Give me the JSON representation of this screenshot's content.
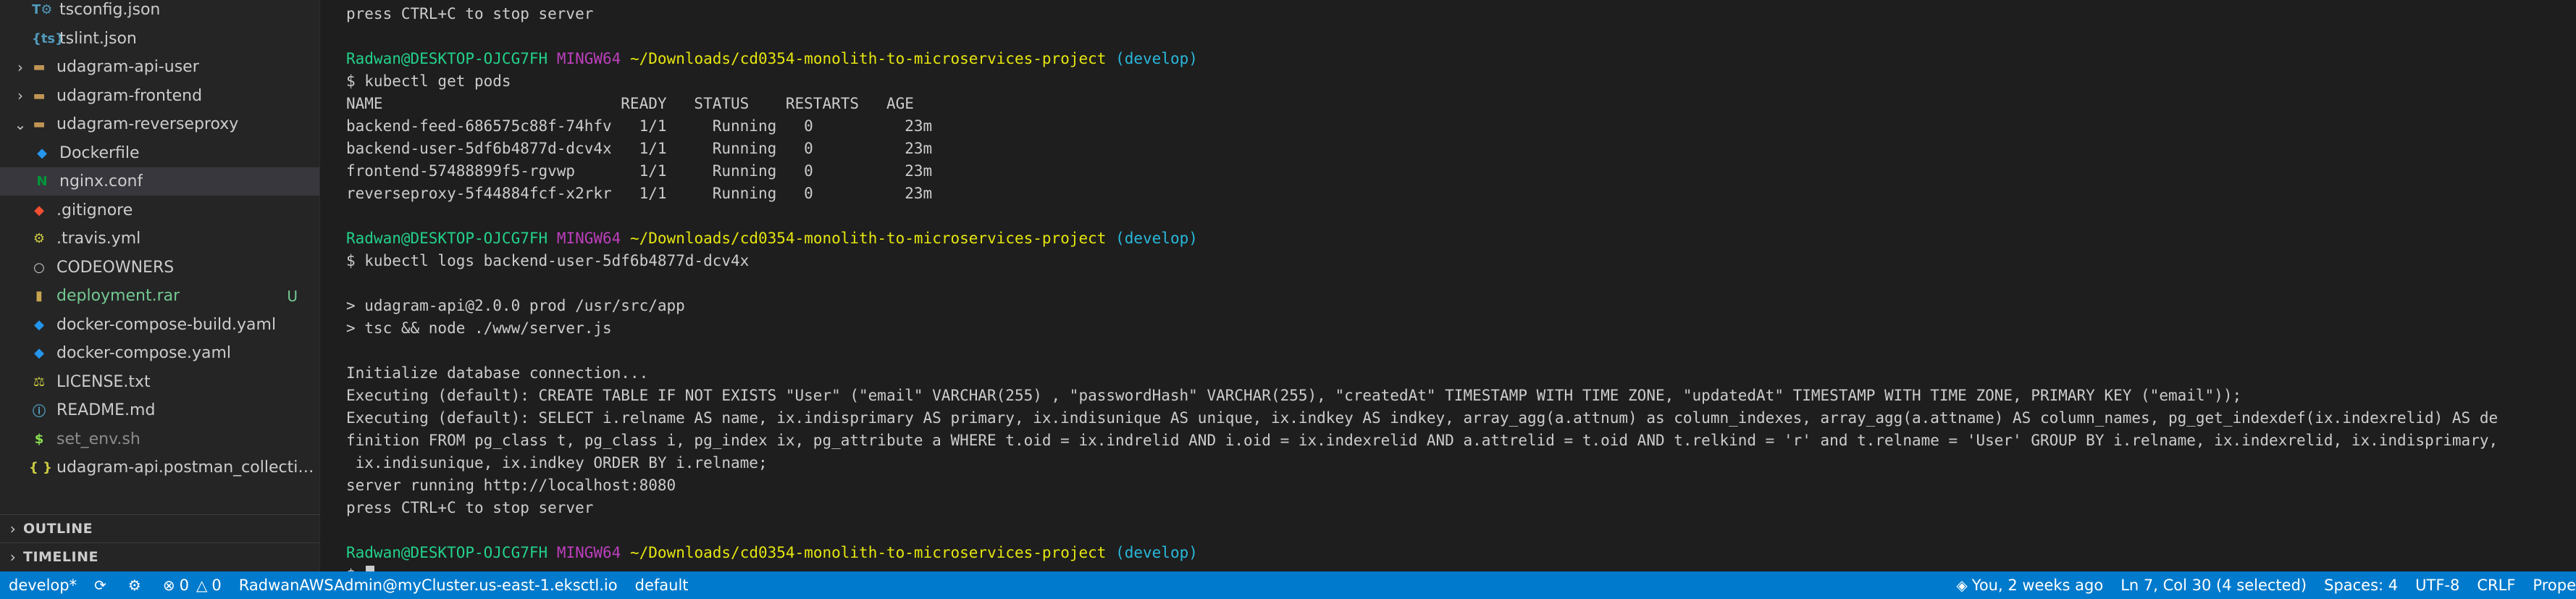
{
  "explorer": {
    "items": [
      {
        "label": "tsconfig.json",
        "indent": 2,
        "chevron": "",
        "icon": "T⚙",
        "icon_color": "#519aba",
        "label_color": "#cccccc",
        "badge": "",
        "selected": false
      },
      {
        "label": "tslint.json",
        "indent": 2,
        "chevron": "",
        "icon": "{ts}",
        "icon_color": "#519aba",
        "label_color": "#cccccc",
        "badge": "",
        "selected": false
      },
      {
        "label": "udagram-api-user",
        "indent": 1,
        "chevron": "›",
        "icon": "▬",
        "icon_color": "#c09553",
        "label_color": "#cccccc",
        "badge": "",
        "selected": false
      },
      {
        "label": "udagram-frontend",
        "indent": 1,
        "chevron": "›",
        "icon": "▬",
        "icon_color": "#c09553",
        "label_color": "#cccccc",
        "badge": "",
        "selected": false
      },
      {
        "label": "udagram-reverseproxy",
        "indent": 1,
        "chevron": "⌄",
        "icon": "▬",
        "icon_color": "#c09553",
        "label_color": "#cccccc",
        "badge": "",
        "selected": false
      },
      {
        "label": "Dockerfile",
        "indent": 2,
        "chevron": "",
        "icon": "◆",
        "icon_color": "#2496ed",
        "label_color": "#cccccc",
        "badge": "",
        "selected": false
      },
      {
        "label": "nginx.conf",
        "indent": 2,
        "chevron": "",
        "icon": "N",
        "icon_color": "#009639",
        "label_color": "#cccccc",
        "badge": "",
        "selected": true
      },
      {
        "label": ".gitignore",
        "indent": 1,
        "chevron": "",
        "icon": "◆",
        "icon_color": "#f14e32",
        "label_color": "#cccccc",
        "badge": "",
        "selected": false
      },
      {
        "label": ".travis.yml",
        "indent": 1,
        "chevron": "",
        "icon": "⚙",
        "icon_color": "#cbcb41",
        "label_color": "#cccccc",
        "badge": "",
        "selected": false
      },
      {
        "label": "CODEOWNERS",
        "indent": 1,
        "chevron": "",
        "icon": "○",
        "icon_color": "#cccccc",
        "label_color": "#cccccc",
        "badge": "",
        "selected": false
      },
      {
        "label": "deployment.rar",
        "indent": 1,
        "chevron": "",
        "icon": "▮",
        "icon_color": "#c9a550",
        "label_color": "#73c991",
        "badge": "U",
        "selected": false
      },
      {
        "label": "docker-compose-build.yaml",
        "indent": 1,
        "chevron": "",
        "icon": "◆",
        "icon_color": "#2496ed",
        "label_color": "#cccccc",
        "badge": "",
        "selected": false
      },
      {
        "label": "docker-compose.yaml",
        "indent": 1,
        "chevron": "",
        "icon": "◆",
        "icon_color": "#2496ed",
        "label_color": "#cccccc",
        "badge": "",
        "selected": false
      },
      {
        "label": "LICENSE.txt",
        "indent": 1,
        "chevron": "",
        "icon": "⚖",
        "icon_color": "#cbcb41",
        "label_color": "#cccccc",
        "badge": "",
        "selected": false
      },
      {
        "label": "README.md",
        "indent": 1,
        "chevron": "",
        "icon": "ⓘ",
        "icon_color": "#519aba",
        "label_color": "#cccccc",
        "badge": "",
        "selected": false
      },
      {
        "label": "set_env.sh",
        "indent": 1,
        "chevron": "",
        "icon": "$",
        "icon_color": "#89e051",
        "label_color": "#8c8c8c",
        "badge": "",
        "selected": false
      },
      {
        "label": "udagram-api.postman_collectio...",
        "indent": 1,
        "chevron": "",
        "icon": "{ }",
        "icon_color": "#cbcb41",
        "label_color": "#cccccc",
        "badge": "",
        "selected": false
      }
    ]
  },
  "sections": {
    "outline": "OUTLINE",
    "timeline": "TIMELINE"
  },
  "terminal": {
    "lines": [
      {
        "text": "press CTRL+C to stop server"
      },
      {
        "text": ""
      },
      {
        "prompt": {
          "user": "Radwan@DESKTOP-OJCG7FH",
          "env": "MINGW64",
          "path": "~/Downloads/cd0354-monolith-to-microservices-project",
          "branch": "(develop)"
        }
      },
      {
        "text": "$ kubectl get pods"
      },
      {
        "text": "NAME                          READY   STATUS    RESTARTS   AGE"
      },
      {
        "text": "backend-feed-686575c88f-74hfv   1/1     Running   0          23m"
      },
      {
        "text": "backend-user-5df6b4877d-dcv4x   1/1     Running   0          23m"
      },
      {
        "text": "frontend-57488899f5-rgvwp       1/1     Running   0          23m"
      },
      {
        "text": "reverseproxy-5f44884fcf-x2rkr   1/1     Running   0          23m"
      },
      {
        "text": ""
      },
      {
        "prompt": {
          "user": "Radwan@DESKTOP-OJCG7FH",
          "env": "MINGW64",
          "path": "~/Downloads/cd0354-monolith-to-microservices-project",
          "branch": "(develop)"
        }
      },
      {
        "text": "$ kubectl logs backend-user-5df6b4877d-dcv4x"
      },
      {
        "text": ""
      },
      {
        "text": "> udagram-api@2.0.0 prod /usr/src/app"
      },
      {
        "text": "> tsc && node ./www/server.js"
      },
      {
        "text": ""
      },
      {
        "text": "Initialize database connection..."
      },
      {
        "text": "Executing (default): CREATE TABLE IF NOT EXISTS \"User\" (\"email\" VARCHAR(255) , \"passwordHash\" VARCHAR(255), \"createdAt\" TIMESTAMP WITH TIME ZONE, \"updatedAt\" TIMESTAMP WITH TIME ZONE, PRIMARY KEY (\"email\"));"
      },
      {
        "text": "Executing (default): SELECT i.relname AS name, ix.indisprimary AS primary, ix.indisunique AS unique, ix.indkey AS indkey, array_agg(a.attnum) as column_indexes, array_agg(a.attname) AS column_names, pg_get_indexdef(ix.indexrelid) AS de"
      },
      {
        "text": "finition FROM pg_class t, pg_class i, pg_index ix, pg_attribute a WHERE t.oid = ix.indrelid AND i.oid = ix.indexrelid AND a.attrelid = t.oid AND t.relkind = 'r' and t.relname = 'User' GROUP BY i.relname, ix.indexrelid, ix.indisprimary,"
      },
      {
        "text": " ix.indisunique, ix.indkey ORDER BY i.relname;"
      },
      {
        "text": "server running http://localhost:8080"
      },
      {
        "text": "press CTRL+C to stop server"
      },
      {
        "text": ""
      },
      {
        "prompt": {
          "user": "Radwan@DESKTOP-OJCG7FH",
          "env": "MINGW64",
          "path": "~/Downloads/cd0354-monolith-to-microservices-project",
          "branch": "(develop)"
        }
      },
      {
        "text": "$ ",
        "cursor": true
      }
    ]
  },
  "statusbar": {
    "branch": "develop*",
    "errors": "0",
    "warnings": "0",
    "context": "RadwanAWSAdmin@myCluster.us-east-1.eksctl.io",
    "namespace": "default",
    "blame": "You, 2 weeks ago",
    "position": "Ln 7, Col 30 (4 selected)",
    "spaces": "Spaces: 4",
    "encoding": "UTF-8",
    "eol": "CRLF",
    "extra": "Prope"
  },
  "colors": {
    "statusbar": "#007acc",
    "sidebar": "#252526",
    "terminal_bg": "#1e1e1e",
    "prompt_user": "#23d18b",
    "prompt_env": "#bc3fbc",
    "prompt_path": "#e5e510",
    "prompt_branch": "#29b8db"
  }
}
